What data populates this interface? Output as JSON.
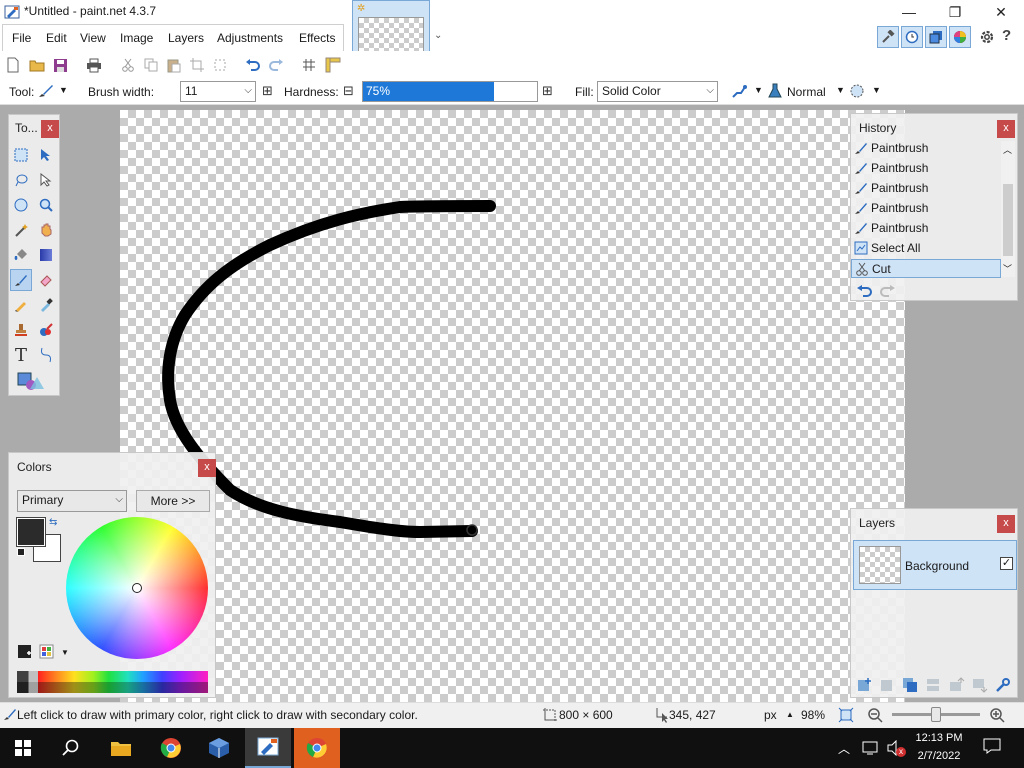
{
  "window": {
    "title": "*Untitled - paint.net 4.3.7",
    "minimize": "—",
    "restore": "❐",
    "close": "✕"
  },
  "menu": [
    "File",
    "Edit",
    "View",
    "Image",
    "Layers",
    "Adjustments",
    "Effects"
  ],
  "toolbar": {
    "tool_label": "Tool:",
    "brush_width_label": "Brush width:",
    "brush_width_value": "11",
    "hardness_label": "Hardness:",
    "hardness_value": "75%",
    "hardness_fraction": 0.75,
    "fill_label": "Fill:",
    "fill_value": "Solid Color",
    "blend_mode": "Normal",
    "minus": "⊟",
    "plus": "⊞"
  },
  "tools_panel": {
    "title": "To...",
    "close": "x"
  },
  "history": {
    "title": "History",
    "close": "x",
    "items": [
      {
        "label": "Paintbrush",
        "icon": "paintbrush-icon"
      },
      {
        "label": "Paintbrush",
        "icon": "paintbrush-icon"
      },
      {
        "label": "Paintbrush",
        "icon": "paintbrush-icon"
      },
      {
        "label": "Paintbrush",
        "icon": "paintbrush-icon"
      },
      {
        "label": "Paintbrush",
        "icon": "paintbrush-icon"
      },
      {
        "label": "Select All",
        "icon": "select-all-icon"
      },
      {
        "label": "Cut",
        "icon": "scissors-icon",
        "selected": true
      }
    ]
  },
  "colors": {
    "title": "Colors",
    "close": "x",
    "mode": "Primary",
    "more_button": "More >>",
    "primary": "#2b2b2b",
    "secondary": "#ffffff"
  },
  "layers": {
    "title": "Layers",
    "close": "x",
    "items": [
      {
        "name": "Background",
        "visible": true
      }
    ]
  },
  "status": {
    "hint": "Left click to draw with primary color, right click to draw with secondary color.",
    "image_size": "800 × 600",
    "cursor_pos": "345, 427",
    "units": "px",
    "zoom": "98%",
    "zoom_level_fraction": 0.5
  },
  "taskbar": {
    "time": "12:13 PM",
    "date": "2/7/2022",
    "badge": "x"
  },
  "colors_theme": {
    "accent_blue": "#1e78d8",
    "close_red": "#c74a4a",
    "selection": "#cfe3f7"
  }
}
